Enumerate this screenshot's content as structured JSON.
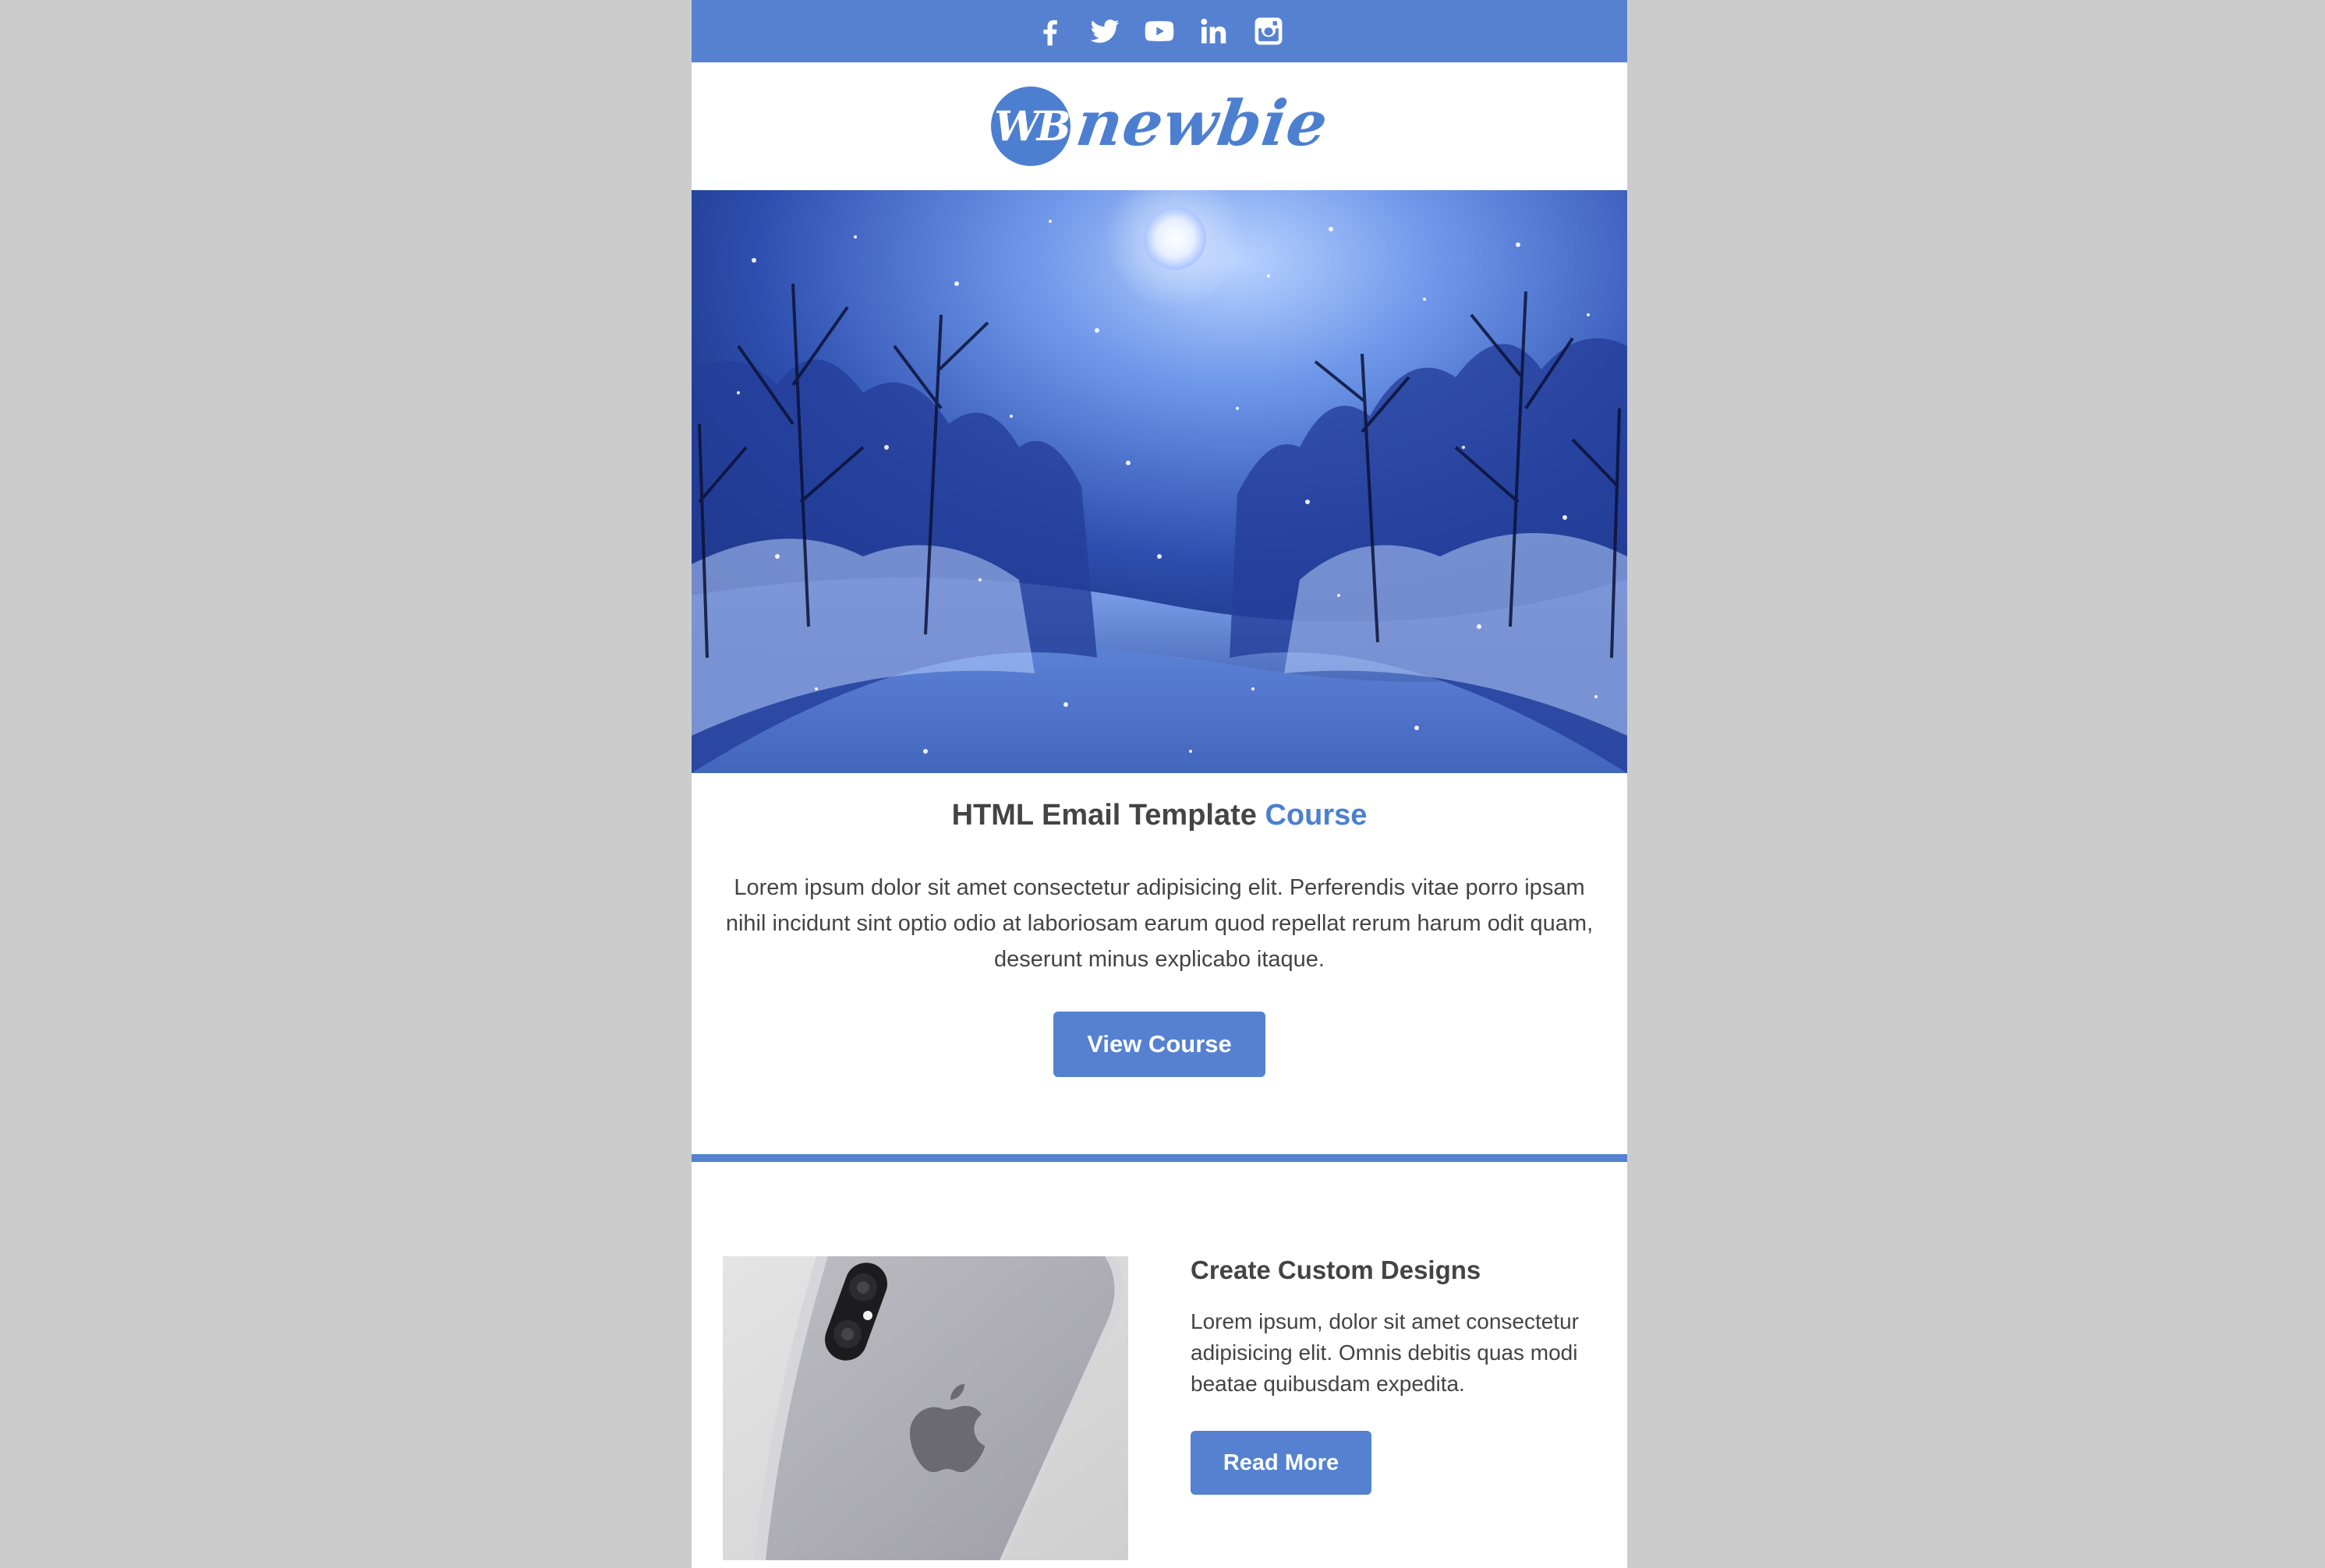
{
  "brand": {
    "logo_mark": "WB",
    "logo_text": "newbie",
    "accent_color": "#4d7fd1",
    "bar_color": "#5581d0",
    "background_color": "#cccccc"
  },
  "social": [
    {
      "name": "facebook",
      "icon": "facebook-icon"
    },
    {
      "name": "twitter",
      "icon": "twitter-icon"
    },
    {
      "name": "youtube",
      "icon": "youtube-icon"
    },
    {
      "name": "linkedin",
      "icon": "linkedin-icon"
    },
    {
      "name": "instagram",
      "icon": "instagram-icon"
    }
  ],
  "hero": {
    "image": "snowy forest under a full moon at night"
  },
  "course": {
    "title_main": "HTML Email Template ",
    "title_accent": "Course",
    "body": "Lorem ipsum dolor sit amet consectetur adipisicing elit. Perferendis vitae porro ipsam nihil incidunt sint optio odio at laboriosam earum quod repellat rerum harum odit quam, deserunt minus explicabo itaque.",
    "button": "View Course"
  },
  "feature": {
    "image": "silver smartphone back with camera and apple logo",
    "title": "Create Custom Designs",
    "body": "Lorem ipsum, dolor sit amet consectetur adipisicing elit. Omnis debitis quas modi beatae quibusdam expedita.",
    "button": "Read More"
  }
}
